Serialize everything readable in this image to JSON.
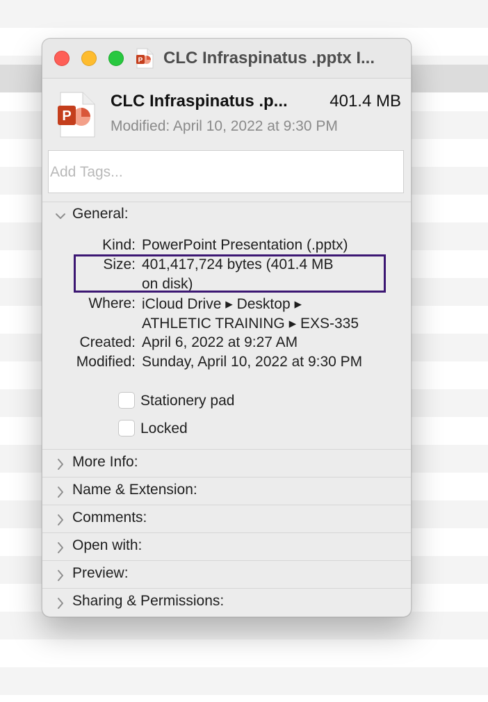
{
  "window": {
    "title": "CLC Infraspinatus .pptx I..."
  },
  "header": {
    "file_name": "CLC Infraspinatus .p...",
    "file_size": "401.4 MB",
    "modified": "Modified: April 10, 2022 at 9:30 PM",
    "icon": "powerpoint-file-icon"
  },
  "tags": {
    "placeholder": "Add Tags...",
    "value": ""
  },
  "general": {
    "label": "General:",
    "expanded": true,
    "rows": [
      {
        "label": "Kind:",
        "lines": [
          "PowerPoint Presentation (.pptx)"
        ]
      },
      {
        "label": "Size:",
        "lines": [
          "401,417,724 bytes (401.4 MB",
          "on disk)"
        ]
      },
      {
        "label": "Where:",
        "lines": [
          "iCloud Drive ▸ Desktop ▸",
          "ATHLETIC TRAINING ▸ EXS-335"
        ]
      },
      {
        "label": "Created:",
        "lines": [
          "April 6, 2022 at 9:27 AM"
        ]
      },
      {
        "label": "Modified:",
        "lines": [
          "Sunday, April 10, 2022 at 9:30 PM"
        ]
      }
    ],
    "stationery_label": "Stationery pad",
    "stationery_checked": false,
    "locked_label": "Locked",
    "locked_checked": false
  },
  "sections": [
    {
      "label": "More Info:",
      "expanded": false
    },
    {
      "label": "Name & Extension:",
      "expanded": false
    },
    {
      "label": "Comments:",
      "expanded": false
    },
    {
      "label": "Open with:",
      "expanded": false
    },
    {
      "label": "Preview:",
      "expanded": false
    },
    {
      "label": "Sharing & Permissions:",
      "expanded": false
    }
  ],
  "colors": {
    "highlight": "#3c1773",
    "powerpoint": "#c43e1c"
  }
}
